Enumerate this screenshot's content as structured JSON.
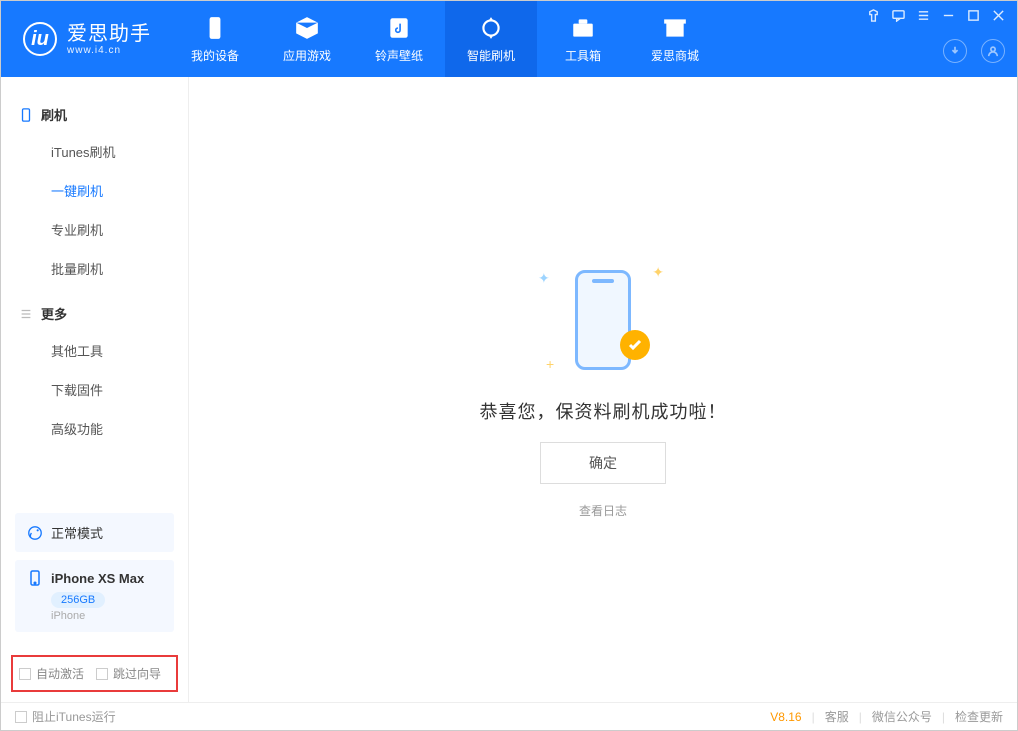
{
  "app": {
    "name_cn": "爱思助手",
    "name_en": "www.i4.cn"
  },
  "nav": {
    "items": [
      {
        "label": "我的设备",
        "icon": "device-icon"
      },
      {
        "label": "应用游戏",
        "icon": "cube-icon"
      },
      {
        "label": "铃声壁纸",
        "icon": "music-icon"
      },
      {
        "label": "智能刷机",
        "icon": "refresh-icon",
        "active": true
      },
      {
        "label": "工具箱",
        "icon": "toolbox-icon"
      },
      {
        "label": "爱思商城",
        "icon": "shop-icon"
      }
    ]
  },
  "sidebar": {
    "group1": {
      "title": "刷机",
      "items": [
        "iTunes刷机",
        "一键刷机",
        "专业刷机",
        "批量刷机"
      ],
      "active_index": 1
    },
    "group2": {
      "title": "更多",
      "items": [
        "其他工具",
        "下载固件",
        "高级功能"
      ]
    },
    "mode": {
      "label": "正常模式"
    },
    "device": {
      "name": "iPhone XS Max",
      "storage": "256GB",
      "type": "iPhone"
    },
    "bottom": {
      "auto_activate": "自动激活",
      "skip_guide": "跳过向导"
    }
  },
  "main": {
    "message": "恭喜您，保资料刷机成功啦！",
    "ok": "确定",
    "view_log": "查看日志"
  },
  "footer": {
    "block_itunes": "阻止iTunes运行",
    "version": "V8.16",
    "links": [
      "客服",
      "微信公众号",
      "检查更新"
    ]
  }
}
